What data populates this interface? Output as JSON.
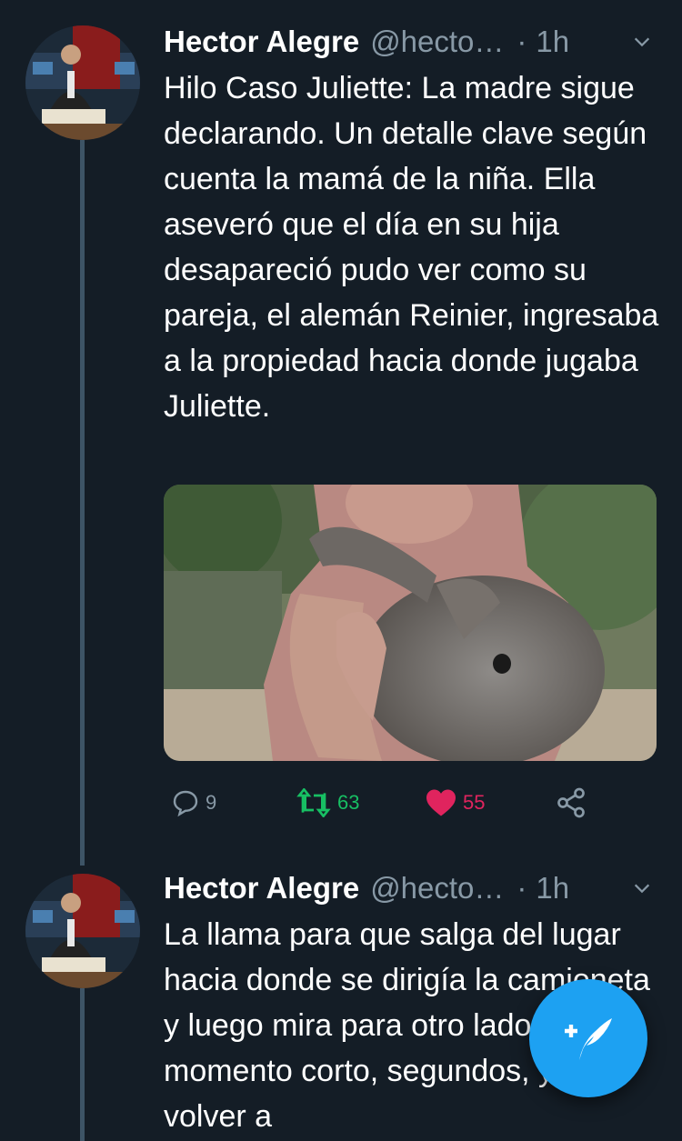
{
  "tweets": [
    {
      "name": "Hector Alegre",
      "handle": "@hecto…",
      "dot": "·",
      "time": "1h",
      "text": "Hilo Caso Juliette: La madre sigue declarando. Un detalle clave según cuenta la mamá de la niña. Ella aseveró que el día en su hija desapareció pudo ver como su pareja, el alemán Reinier, ingresaba a la propiedad hacia donde jugaba Juliette.",
      "avatar_text": "CAUSA JUSTA",
      "stats": {
        "replies": "9",
        "retweets": "63",
        "likes": "55"
      }
    },
    {
      "name": "Hector Alegre",
      "handle": "@hecto…",
      "dot": "·",
      "time": "1h",
      "text": "La llama para que salga del lugar hacia donde se dirigía la camioneta y luego mira para otro lado por un momento corto, segundos, y al volver a",
      "avatar_text": "CAUSA JUSTA"
    }
  ],
  "colors": {
    "background": "#141d26",
    "muted": "#8899a6",
    "retweet": "#17bf63",
    "like": "#e0245e",
    "accent": "#1da1f2"
  },
  "icons": {
    "reply": "reply-icon",
    "retweet": "retweet-icon",
    "like": "heart-icon",
    "share": "share-icon",
    "compose": "compose-feather-icon",
    "caret": "chevron-down-icon"
  }
}
